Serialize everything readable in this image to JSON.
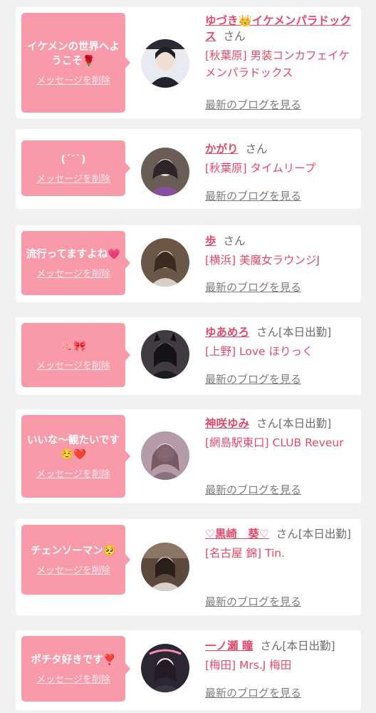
{
  "items": [
    {
      "message": "イケメンの世界へようこそ🌹",
      "delete_label": "メッセージを削除",
      "name": "ゆづき👑イケメンパラドックス",
      "honorific": "さん",
      "status": "",
      "shop": "[秋葉原] 男装コンカフェイケメンパラドックス",
      "blog_label": "最新のブログを見る",
      "avatar_icon": "avatar-photo"
    },
    {
      "message": "(ˊ˘ˋ)",
      "delete_label": "メッセージを削除",
      "name": "かがり",
      "honorific": "さん",
      "status": "",
      "shop": "[秋葉原] タイムリープ",
      "blog_label": "最新のブログを見る",
      "avatar_icon": "avatar-photo"
    },
    {
      "message": "流行ってますよね💗",
      "delete_label": "メッセージを削除",
      "name": "歩",
      "honorific": "さん",
      "status": "",
      "shop": "[横浜] 美魔女ラウンジJ",
      "blog_label": "最新のブログを見る",
      "avatar_icon": "avatar-photo"
    },
    {
      "message": "🧠🎀",
      "delete_label": "メッセージを削除",
      "name": "ゆあめろ",
      "honorific": "さん",
      "status": "[本日出勤]",
      "shop": "[上野] Love ほりっく",
      "blog_label": "最新のブログを見る",
      "avatar_icon": "avatar-photo"
    },
    {
      "message": "いいな〜観たいです☺️❤️",
      "delete_label": "メッセージを削除",
      "name": "神咲ゆみ",
      "honorific": "さん",
      "status": "[本日出勤]",
      "shop": "[網島駅東口] CLUB Reveur",
      "blog_label": "最新のブログを見る",
      "avatar_icon": "avatar-photo"
    },
    {
      "message": "チェンソーマン🥺",
      "delete_label": "メッセージを削除",
      "name": "♡黒崎　葵♡",
      "honorific": "さん",
      "status": "[本日出勤]",
      "shop": "[名古屋 錦] Tin.",
      "blog_label": "最新のブログを見る",
      "avatar_icon": "avatar-photo"
    },
    {
      "message": "ポチタ好きです❣️",
      "delete_label": "メッセージを削除",
      "name": "一ノ瀬 瞳",
      "honorific": "さん",
      "status": "[本日出勤]",
      "shop": "[梅田] Mrs.J 梅田",
      "blog_label": "最新のブログを見る",
      "avatar_icon": "avatar-photo"
    }
  ]
}
